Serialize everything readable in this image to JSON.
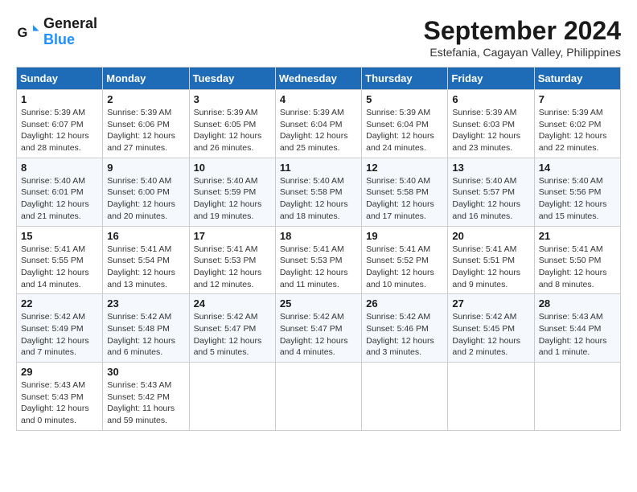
{
  "logo": {
    "line1": "General",
    "line2": "Blue"
  },
  "header": {
    "month": "September 2024",
    "location": "Estefania, Cagayan Valley, Philippines"
  },
  "weekdays": [
    "Sunday",
    "Monday",
    "Tuesday",
    "Wednesday",
    "Thursday",
    "Friday",
    "Saturday"
  ],
  "weeks": [
    [
      {
        "day": "1",
        "sunrise": "5:39 AM",
        "sunset": "6:07 PM",
        "daylight": "12 hours and 28 minutes."
      },
      {
        "day": "2",
        "sunrise": "5:39 AM",
        "sunset": "6:06 PM",
        "daylight": "12 hours and 27 minutes."
      },
      {
        "day": "3",
        "sunrise": "5:39 AM",
        "sunset": "6:05 PM",
        "daylight": "12 hours and 26 minutes."
      },
      {
        "day": "4",
        "sunrise": "5:39 AM",
        "sunset": "6:04 PM",
        "daylight": "12 hours and 25 minutes."
      },
      {
        "day": "5",
        "sunrise": "5:39 AM",
        "sunset": "6:04 PM",
        "daylight": "12 hours and 24 minutes."
      },
      {
        "day": "6",
        "sunrise": "5:39 AM",
        "sunset": "6:03 PM",
        "daylight": "12 hours and 23 minutes."
      },
      {
        "day": "7",
        "sunrise": "5:39 AM",
        "sunset": "6:02 PM",
        "daylight": "12 hours and 22 minutes."
      }
    ],
    [
      {
        "day": "8",
        "sunrise": "5:40 AM",
        "sunset": "6:01 PM",
        "daylight": "12 hours and 21 minutes."
      },
      {
        "day": "9",
        "sunrise": "5:40 AM",
        "sunset": "6:00 PM",
        "daylight": "12 hours and 20 minutes."
      },
      {
        "day": "10",
        "sunrise": "5:40 AM",
        "sunset": "5:59 PM",
        "daylight": "12 hours and 19 minutes."
      },
      {
        "day": "11",
        "sunrise": "5:40 AM",
        "sunset": "5:58 PM",
        "daylight": "12 hours and 18 minutes."
      },
      {
        "day": "12",
        "sunrise": "5:40 AM",
        "sunset": "5:58 PM",
        "daylight": "12 hours and 17 minutes."
      },
      {
        "day": "13",
        "sunrise": "5:40 AM",
        "sunset": "5:57 PM",
        "daylight": "12 hours and 16 minutes."
      },
      {
        "day": "14",
        "sunrise": "5:40 AM",
        "sunset": "5:56 PM",
        "daylight": "12 hours and 15 minutes."
      }
    ],
    [
      {
        "day": "15",
        "sunrise": "5:41 AM",
        "sunset": "5:55 PM",
        "daylight": "12 hours and 14 minutes."
      },
      {
        "day": "16",
        "sunrise": "5:41 AM",
        "sunset": "5:54 PM",
        "daylight": "12 hours and 13 minutes."
      },
      {
        "day": "17",
        "sunrise": "5:41 AM",
        "sunset": "5:53 PM",
        "daylight": "12 hours and 12 minutes."
      },
      {
        "day": "18",
        "sunrise": "5:41 AM",
        "sunset": "5:53 PM",
        "daylight": "12 hours and 11 minutes."
      },
      {
        "day": "19",
        "sunrise": "5:41 AM",
        "sunset": "5:52 PM",
        "daylight": "12 hours and 10 minutes."
      },
      {
        "day": "20",
        "sunrise": "5:41 AM",
        "sunset": "5:51 PM",
        "daylight": "12 hours and 9 minutes."
      },
      {
        "day": "21",
        "sunrise": "5:41 AM",
        "sunset": "5:50 PM",
        "daylight": "12 hours and 8 minutes."
      }
    ],
    [
      {
        "day": "22",
        "sunrise": "5:42 AM",
        "sunset": "5:49 PM",
        "daylight": "12 hours and 7 minutes."
      },
      {
        "day": "23",
        "sunrise": "5:42 AM",
        "sunset": "5:48 PM",
        "daylight": "12 hours and 6 minutes."
      },
      {
        "day": "24",
        "sunrise": "5:42 AM",
        "sunset": "5:47 PM",
        "daylight": "12 hours and 5 minutes."
      },
      {
        "day": "25",
        "sunrise": "5:42 AM",
        "sunset": "5:47 PM",
        "daylight": "12 hours and 4 minutes."
      },
      {
        "day": "26",
        "sunrise": "5:42 AM",
        "sunset": "5:46 PM",
        "daylight": "12 hours and 3 minutes."
      },
      {
        "day": "27",
        "sunrise": "5:42 AM",
        "sunset": "5:45 PM",
        "daylight": "12 hours and 2 minutes."
      },
      {
        "day": "28",
        "sunrise": "5:43 AM",
        "sunset": "5:44 PM",
        "daylight": "12 hours and 1 minute."
      }
    ],
    [
      {
        "day": "29",
        "sunrise": "5:43 AM",
        "sunset": "5:43 PM",
        "daylight": "12 hours and 0 minutes."
      },
      {
        "day": "30",
        "sunrise": "5:43 AM",
        "sunset": "5:42 PM",
        "daylight": "11 hours and 59 minutes."
      },
      null,
      null,
      null,
      null,
      null
    ]
  ]
}
